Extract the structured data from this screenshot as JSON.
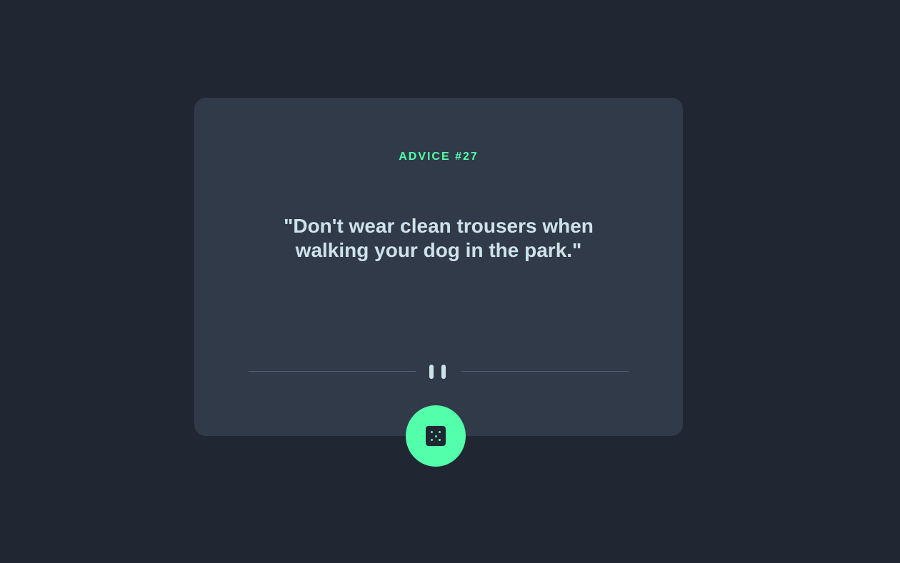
{
  "card": {
    "advice_label": "ADVICE #27",
    "quote": "\"Don't wear clean trousers when walking your dog in the park.\""
  },
  "icons": {
    "divider": "pause-icon",
    "button": "dice-icon"
  },
  "colors": {
    "background": "#202733",
    "card": "#313a48",
    "accent": "#53ffaa",
    "text": "#cee3e9",
    "divider": "#4f5d74"
  }
}
